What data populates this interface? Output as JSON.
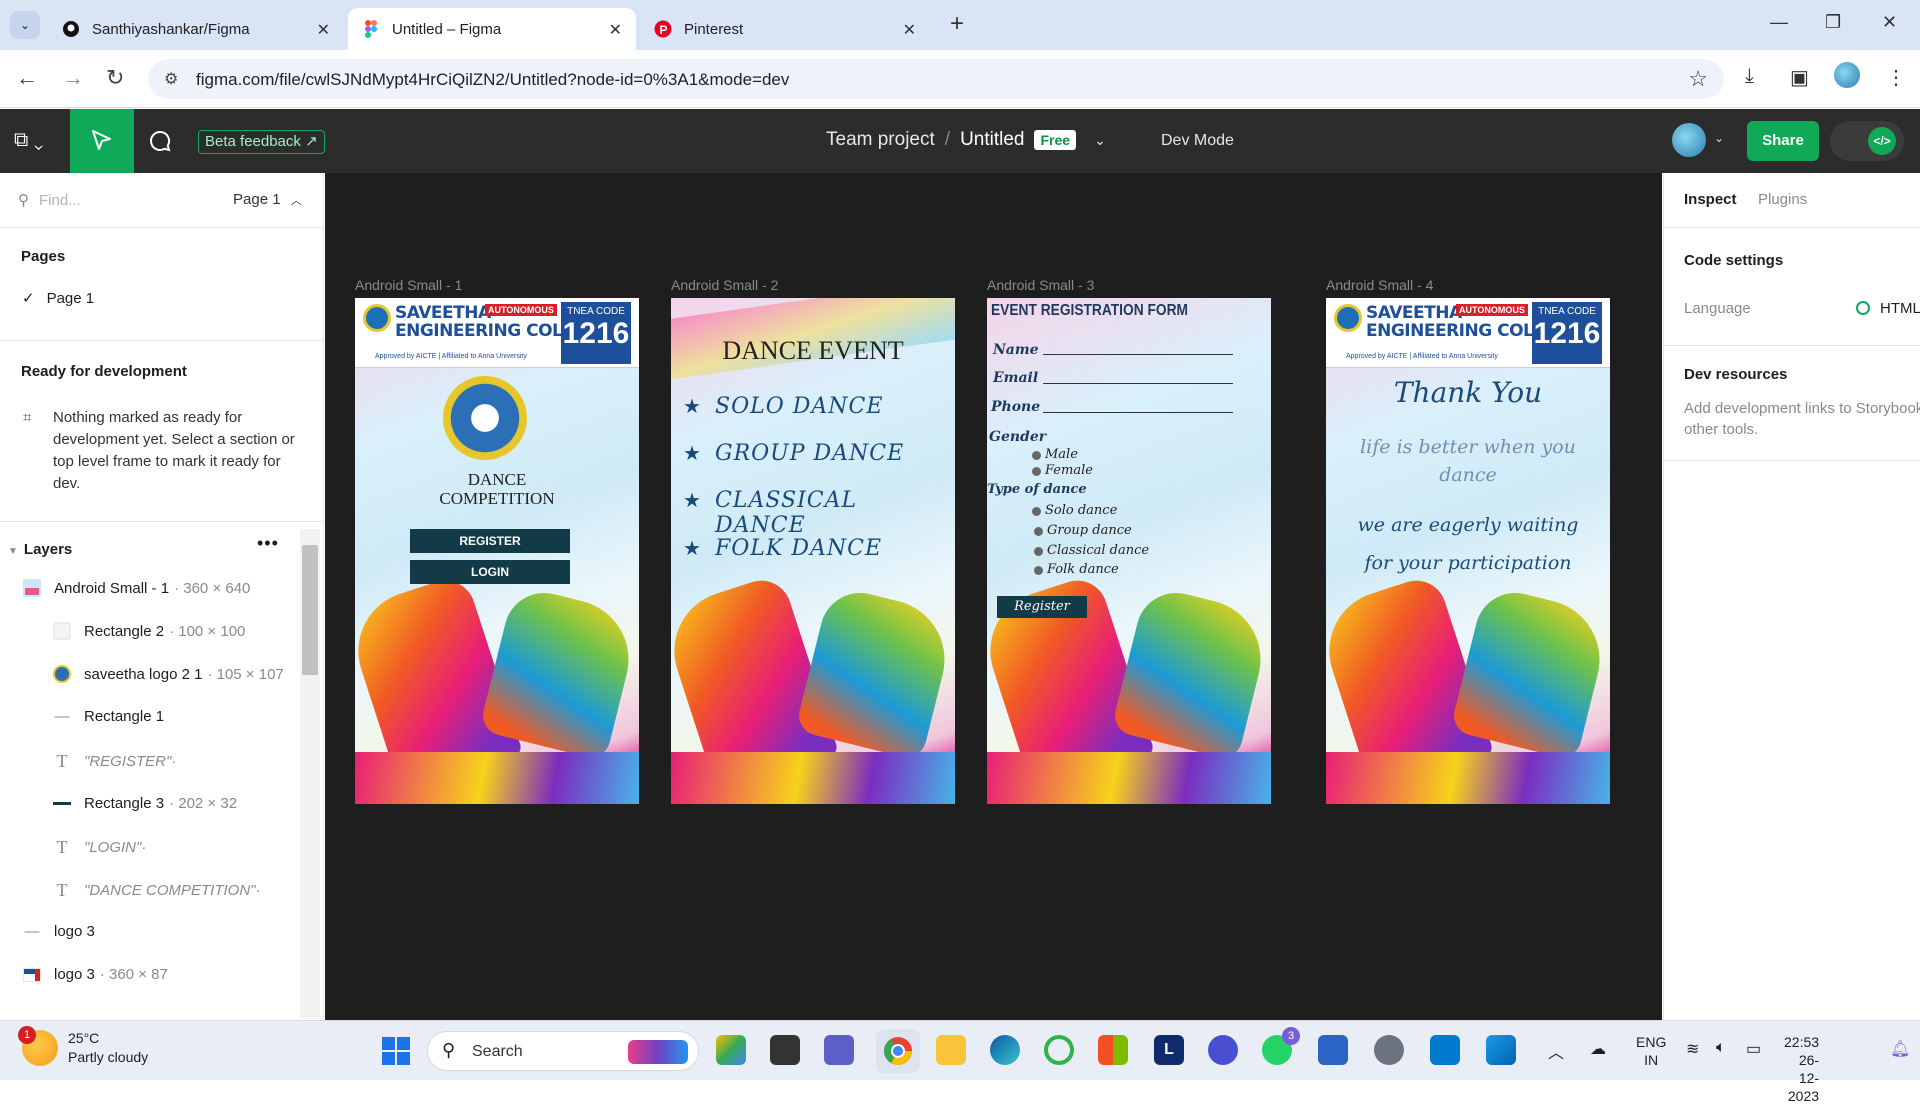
{
  "browser": {
    "tabs": [
      {
        "title": "Santhiyashankar/Figma",
        "icon": "github-icon"
      },
      {
        "title": "Untitled – Figma",
        "icon": "figma-icon",
        "active": true
      },
      {
        "title": "Pinterest",
        "icon": "pinterest-icon"
      }
    ],
    "url": "figma.com/file/cwlSJNdMypt4HrCiQilZN2/Untitled?node-id=0%3A1&mode=dev"
  },
  "figma": {
    "beta_feedback": "Beta feedback",
    "team": "Team project",
    "separator": "/",
    "file_title": "Untitled",
    "plan_badge": "Free",
    "dev_mode": "Dev Mode",
    "share": "Share",
    "accent": "#0fa958"
  },
  "left_panel": {
    "find_placeholder": "Find...",
    "page_selector": "Page 1",
    "pages_heading": "Pages",
    "current_page": "Page 1",
    "ready_heading": "Ready for development",
    "ready_message": "Nothing marked as ready for development yet. Select a section or top level frame to mark it ready for dev.",
    "layers_heading": "Layers",
    "layers": [
      {
        "name": "Android Small - 1",
        "dims": "· 360 × 640",
        "icon": "frame-thumb-icon"
      },
      {
        "name": "Rectangle 2",
        "dims": "· 100 × 100",
        "icon": "rectangle-icon"
      },
      {
        "name": "saveetha logo 2 1",
        "dims": "· 105 × 107",
        "icon": "image-thumb-icon"
      },
      {
        "name": "Rectangle 1",
        "dims": "",
        "icon": "line-icon"
      },
      {
        "name": "\"REGISTER\"·",
        "dims": "",
        "icon": "text-icon"
      },
      {
        "name": "Rectangle 3",
        "dims": "· 202 × 32",
        "icon": "dark-line-icon"
      },
      {
        "name": "\"LOGIN\"·",
        "dims": "",
        "icon": "text-icon"
      },
      {
        "name": "\"DANCE COMPETITION\"·",
        "dims": "",
        "icon": "text-icon"
      },
      {
        "name": "logo 3",
        "dims": "",
        "icon": "line-icon"
      },
      {
        "name": "logo 3",
        "dims": "· 360 × 87",
        "icon": "image-thumb-icon"
      }
    ]
  },
  "canvas": {
    "frame_labels": [
      "Android Small - 1",
      "Android Small - 2",
      "Android Small - 3",
      "Android Small - 4"
    ],
    "college": {
      "name_line1": "SAVEETHA",
      "name_line2": "ENGINEERING COLLEGE",
      "autonomous": "AUTONOMOUS",
      "tnea_label": "TNEA CODE",
      "tnea_code": "1216",
      "approval": "Approved by AICTE | Affiliated to Anna University"
    },
    "frame1": {
      "title_line1": "DANCE",
      "title_line2": "COMPETITION",
      "register": "REGISTER",
      "login": "LOGIN"
    },
    "frame2": {
      "title": "DANCE EVENT",
      "items": [
        "SOLO DANCE",
        "GROUP DANCE",
        "CLASSICAL DANCE",
        "FOLK DANCE"
      ],
      "bullet": "★"
    },
    "frame3": {
      "title": "EVENT REGISTRATION FORM",
      "name": "Name",
      "email": "Email",
      "phone": "Phone",
      "gender": "Gender",
      "male": "Male",
      "female": "Female",
      "type": "Type of dance",
      "solo": "Solo dance",
      "group": "Group dance",
      "classical": "Classical dance",
      "folk": "Folk dance",
      "register": "Register"
    },
    "frame4": {
      "thank_you": "Thank You",
      "line1": "life is better when you",
      "line2": "dance",
      "line3": "we are eagerly waiting",
      "line4": "for your participation"
    }
  },
  "right_panel": {
    "tab_inspect": "Inspect",
    "tab_plugins": "Plugins",
    "code_settings": "Code settings",
    "language_label": "Language",
    "language_value": "HTML",
    "dev_resources": "Dev resources",
    "dev_resources_text": "Add development links to Storybook and other tools."
  },
  "taskbar": {
    "temperature": "25°C",
    "weather": "Partly cloudy",
    "weather_badge": "1",
    "search": "Search",
    "whatsapp_badge": "3",
    "lang1": "ENG",
    "lang2": "IN",
    "time": "22:53",
    "date": "26-12-2023"
  }
}
